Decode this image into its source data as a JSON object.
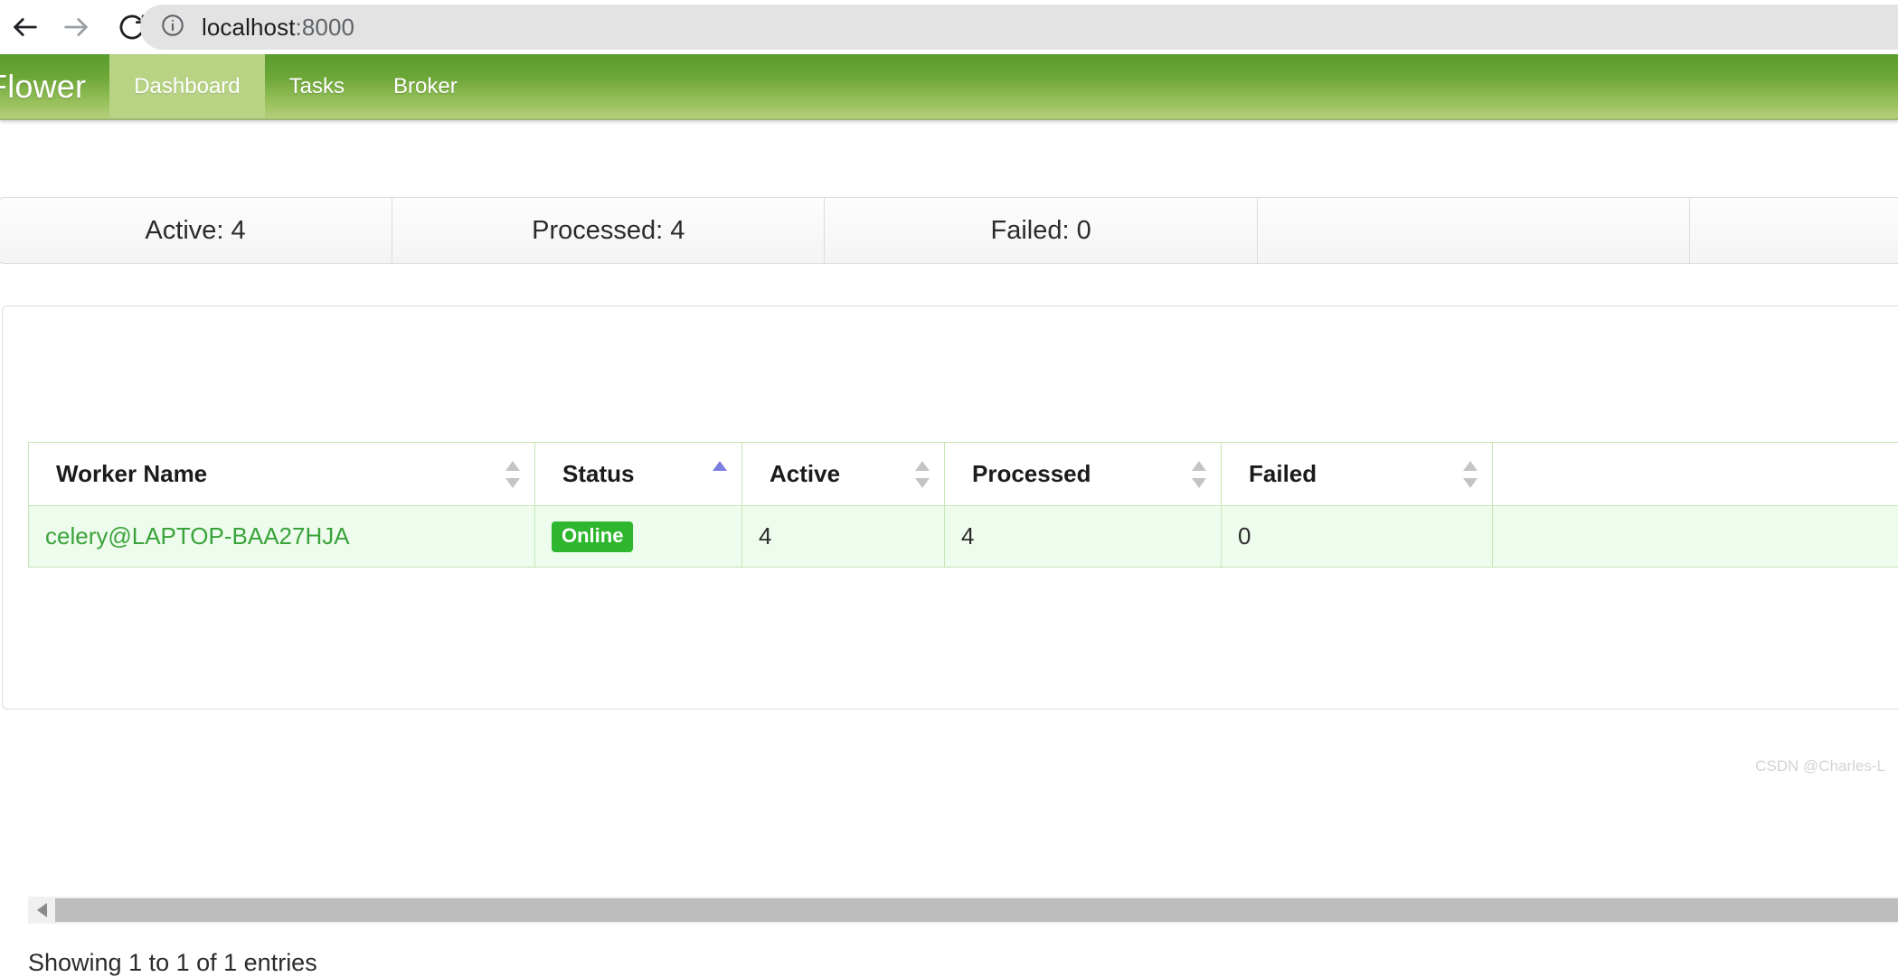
{
  "browser": {
    "back_icon": "arrow-left-icon",
    "forward_icon": "arrow-right-icon",
    "reload_icon": "reload-icon",
    "site_info_icon": "info-circle-icon",
    "url_host": "localhost",
    "url_port": ":8000",
    "url_full": "localhost:8000"
  },
  "navbar": {
    "brand": "Flower",
    "tabs": [
      {
        "label": "Dashboard",
        "active": true
      },
      {
        "label": "Tasks",
        "active": false
      },
      {
        "label": "Broker",
        "active": false
      }
    ]
  },
  "stats": [
    {
      "label": "Active: 4"
    },
    {
      "label": "Processed: 4"
    },
    {
      "label": "Failed: 0"
    },
    {
      "label": ""
    },
    {
      "label": ""
    }
  ],
  "table": {
    "columns": [
      {
        "label": "Worker Name",
        "sort": "none"
      },
      {
        "label": "Status",
        "sort": "asc"
      },
      {
        "label": "Active",
        "sort": "none"
      },
      {
        "label": "Processed",
        "sort": "none"
      },
      {
        "label": "Failed",
        "sort": "none"
      }
    ],
    "rows": [
      {
        "worker_name": "celery@LAPTOP-BAA27HJA",
        "status": "Online",
        "active": "4",
        "processed": "4",
        "failed": "0"
      }
    ],
    "info": "Showing 1 to 1 of 1 entries",
    "scrollbar_left_icon": "triangle-left-icon"
  },
  "watermark": "CSDN @Charles-L",
  "colors": {
    "navbar_top": "#5a9c2f",
    "navbar_bottom": "#b6ce7c",
    "active_tab": "#b8d384",
    "badge_online": "#2eb62e",
    "worker_link": "#3aa33a",
    "row_bg": "#eefcee",
    "row_border": "#c6e6b6",
    "sort_active": "#7b7de0"
  }
}
